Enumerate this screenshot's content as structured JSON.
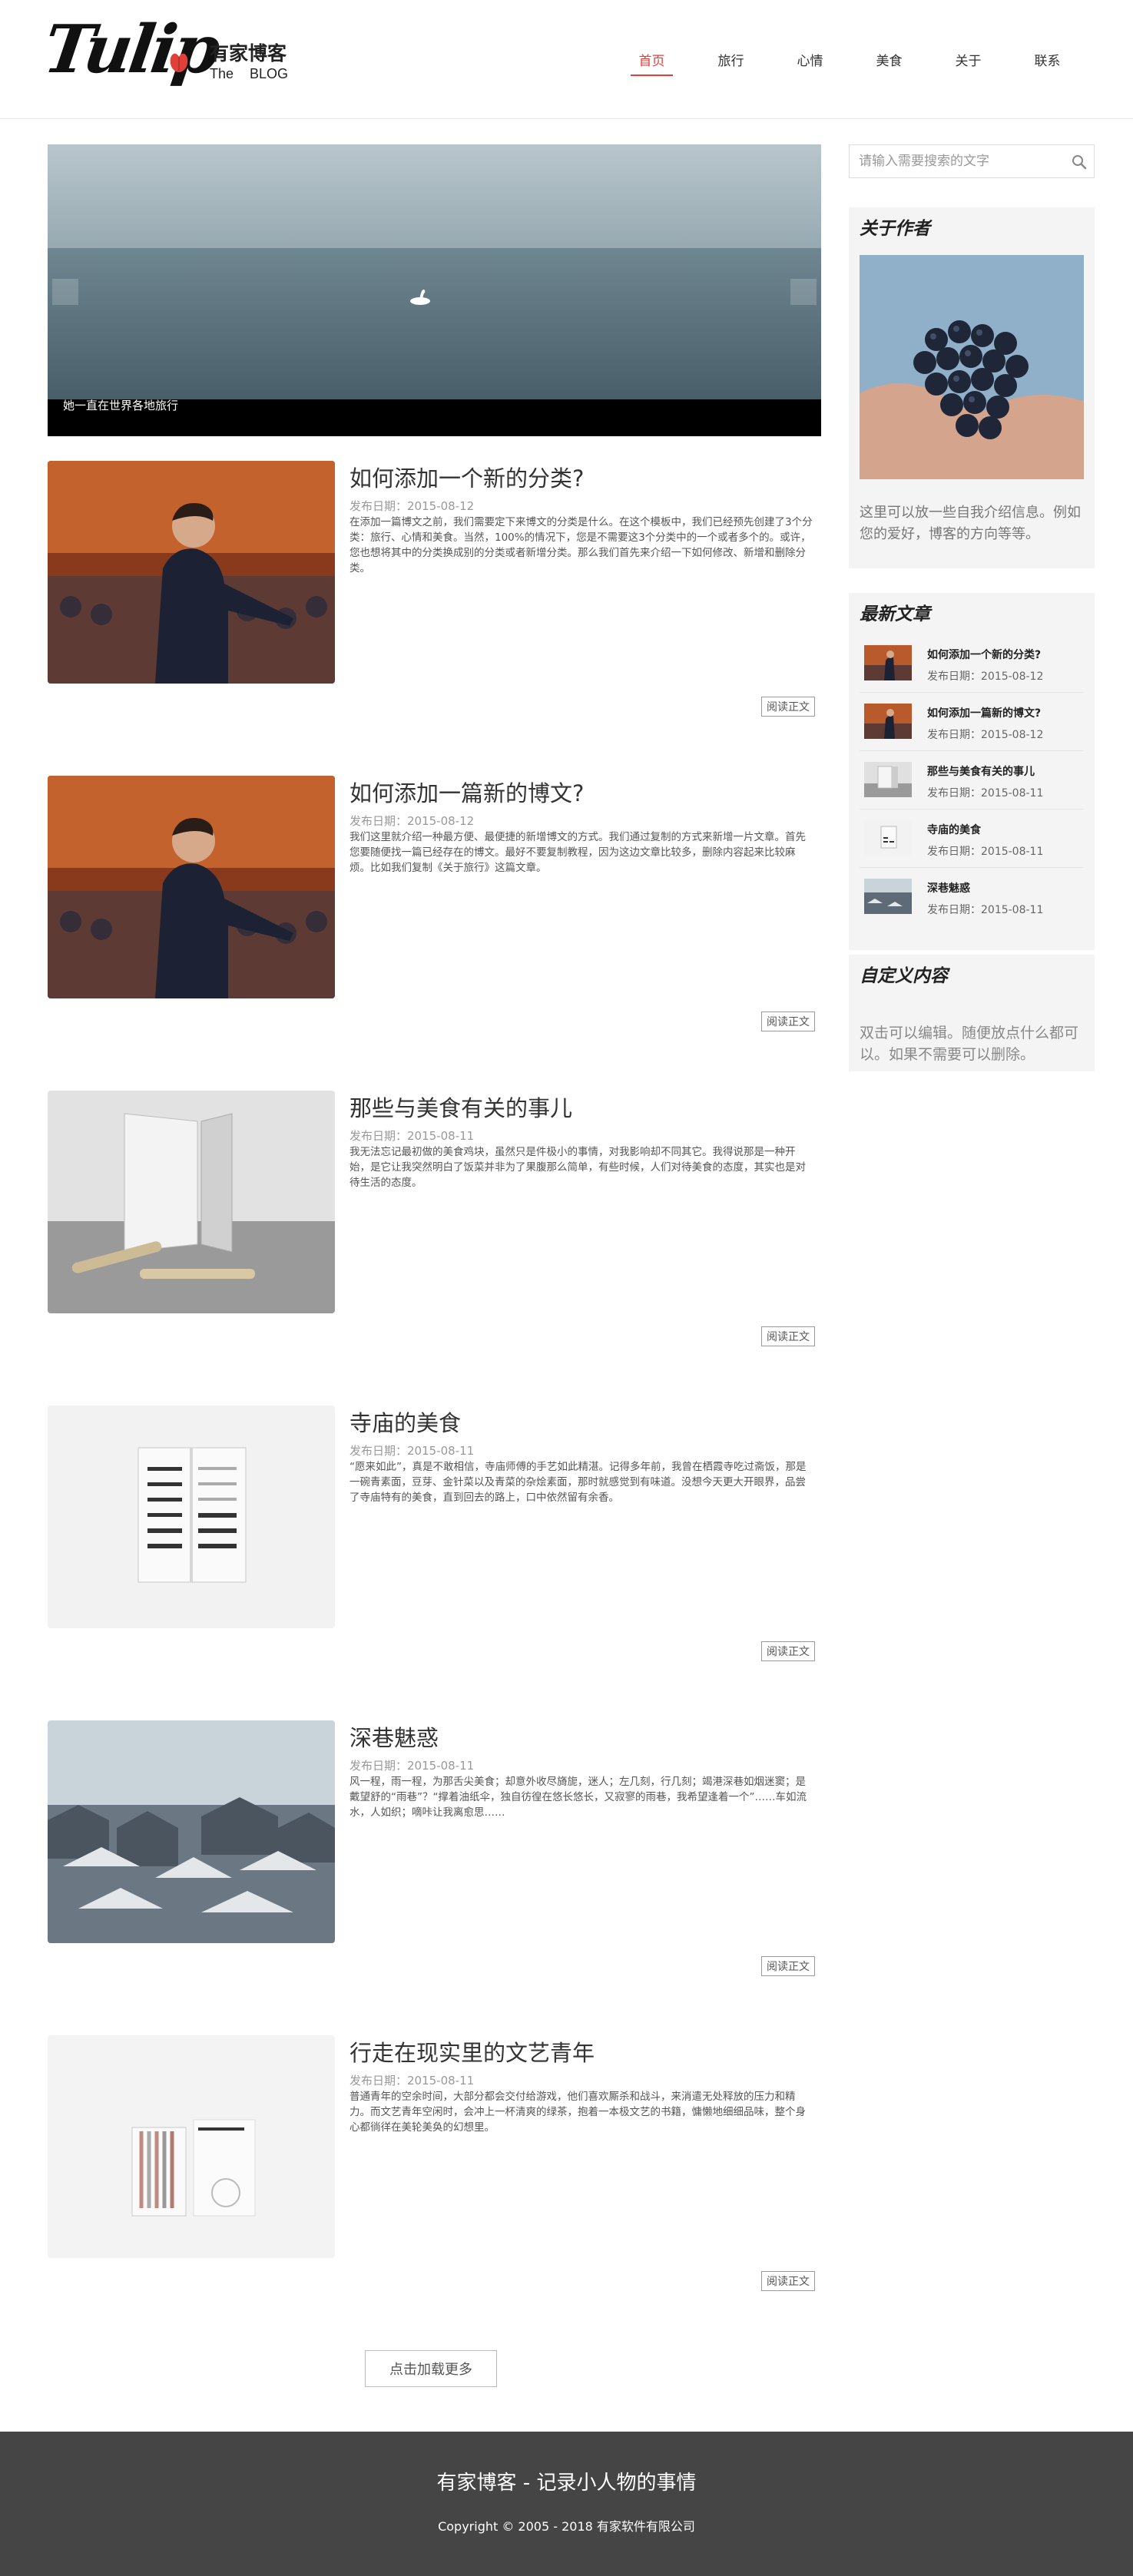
{
  "header": {
    "logo_text": "Tulip",
    "brand_name": "有家博客",
    "brand_sub": "The BLOG",
    "nav": [
      "首页",
      "旅行",
      "心情",
      "美食",
      "关于",
      "联系"
    ],
    "active_nav": "首页",
    "accent_color": "#e0403a"
  },
  "slider": {
    "caption": "她一直在世界各地旅行"
  },
  "posts": [
    {
      "title": "如何添加一个新的分类?",
      "date": "发布日期：2015-08-12",
      "excerpt": "在添加一篇博文之前，我们需要定下来博文的分类是什么。在这个模板中，我们已经预先创建了3个分类：旅行、心情和美食。当然，100%的情况下，您是不需要这3个分类中的一个或者多个的。或许，您也想将其中的分类换成别的分类或者新增分类。那么我们首先来介绍一下如何修改、新增和删除分类。",
      "read_more": "阅读正文",
      "thumb": "speaker"
    },
    {
      "title": "如何添加一篇新的博文?",
      "date": "发布日期：2015-08-12",
      "excerpt": "我们这里就介绍一种最方便、最便捷的新增博文的方式。我们通过复制的方式来新增一片文章。首先您要随便找一篇已经存在的博文。最好不要复制教程，因为这边文章比较多，删除内容起来比较麻烦。比如我们复制《关于旅行》这篇文章。",
      "read_more": "阅读正文",
      "thumb": "speaker"
    },
    {
      "title": "那些与美食有关的事儿",
      "date": "发布日期：2015-08-11",
      "excerpt": "我无法忘记最初做的美食鸡块，虽然只是件极小的事情，对我影响却不同其它。我得说那是一种开始，是它让我突然明白了饭菜并非为了果腹那么简单，有些时候，人们对待美食的态度，其实也是对待生活的态度。",
      "read_more": "阅读正文",
      "thumb": "mirror"
    },
    {
      "title": "寺庙的美食",
      "date": "发布日期：2015-08-11",
      "excerpt": "“愿来如此”，真是不敢相信，寺庙师傅的手艺如此精湛。记得多年前，我曾在栖霞寺吃过斋饭，那是一碗青素面，豆芽、金针菜以及青菜的杂烩素面，那时就感觉到有味道。没想今天更大开眼界，品尝了寺庙特有的美食，直到回去的路上，口中依然留有余香。",
      "read_more": "阅读正文",
      "thumb": "booklet"
    },
    {
      "title": "深巷魅惑",
      "date": "发布日期：2015-08-11",
      "excerpt": "风一程，雨一程，为那舌尖美食；却意外收尽旖旎，迷人；左几刻，行几刻；竭港深巷如烟迷窦；是戴望舒的“雨巷”？“撑着油纸伞，独自彷徨在悠长悠长，又寂寥的雨巷，我希望逢着一个”……车如流水，人如织；嘀咔让我离愈思……",
      "read_more": "阅读正文",
      "thumb": "city"
    },
    {
      "title": "行走在现实里的文艺青年",
      "date": "发布日期：2015-08-11",
      "excerpt": "普通青年的空余时间，大部分都会交付给游戏，他们喜欢厮杀和战斗，来消遣无处释放的压力和精力。而文艺青年空闲时，会冲上一杯清爽的绿茶，抱着一本极文艺的书籍，慵懒地细细品味，整个身心都徜徉在美轮美奂的幻想里。",
      "read_more": "阅读正文",
      "thumb": "books"
    }
  ],
  "load_more": "点击加载更多",
  "sidebar": {
    "search_placeholder": "请输入需要搜索的文字",
    "about_title": "关于作者",
    "about_text": "这里可以放一些自我介绍信息。例如您的爱好，博客的方向等等。",
    "latest_title": "最新文章",
    "latest": [
      {
        "title": "如何添加一个新的分类?",
        "date": "发布日期：2015-08-12",
        "thumb": "speaker"
      },
      {
        "title": "如何添加一篇新的博文?",
        "date": "发布日期：2015-08-12",
        "thumb": "speaker"
      },
      {
        "title": "那些与美食有关的事儿",
        "date": "发布日期：2015-08-11",
        "thumb": "mirror"
      },
      {
        "title": "寺庙的美食",
        "date": "发布日期：2015-08-11",
        "thumb": "booklet"
      },
      {
        "title": "深巷魅惑",
        "date": "发布日期：2015-08-11",
        "thumb": "city"
      }
    ],
    "custom_title": "自定义内容",
    "custom_text": "双击可以编辑。随便放点什么都可以。如果不需要可以删除。"
  },
  "footer": {
    "title": "有家博客 - 记录小人物的事情",
    "copyright": "Copyright © 2005 - 2018 有家软件有限公司"
  }
}
